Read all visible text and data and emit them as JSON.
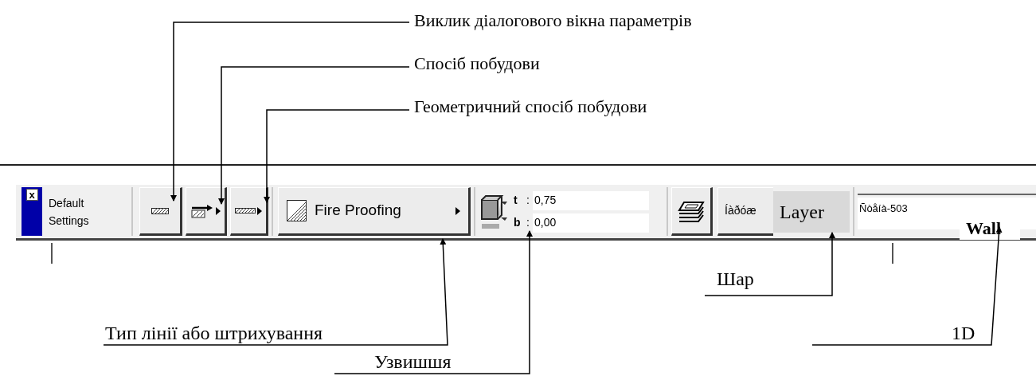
{
  "annotations_top": [
    "Виклик діалогового вікна параметрів",
    "Спосіб побудови",
    "Геометричний спосіб побудови"
  ],
  "toolbar": {
    "checkbox_glyph": "x",
    "checkbox_checked": true,
    "settings_lines": [
      "Default",
      "Settings"
    ],
    "fill_button": {
      "label": "Fire Proofing"
    },
    "elevation": [
      {
        "symbol": "t",
        "separator": ":",
        "value": "0,75"
      },
      {
        "symbol": "b",
        "separator": ":",
        "value": "0,00"
      }
    ],
    "layer": {
      "name": "Íàðóæ",
      "overlay": "Layer"
    },
    "element_id": {
      "value": "Ñòåíà-503",
      "overlay": "Wall"
    }
  },
  "annotations_bottom": [
    "Шар",
    "Тип лінії або штрихування",
    "1D",
    "Узвишшя"
  ]
}
